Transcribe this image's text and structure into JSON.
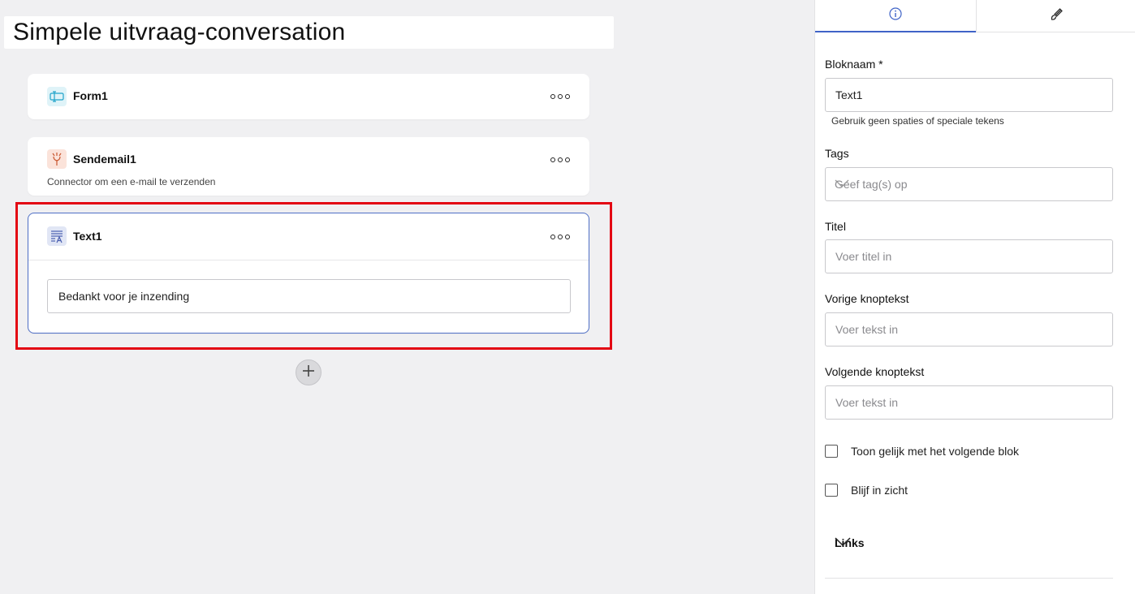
{
  "page_title": "Simpele uitvraag-conversation",
  "blocks": [
    {
      "name": "Form1",
      "icon": "form-icon",
      "icon_color": "#1fa3c9",
      "icon_bg": "#dff3f8"
    },
    {
      "name": "Sendemail1",
      "description": "Connector om een e-mail te verzenden",
      "icon": "email-connector-icon",
      "icon_color": "#c9562f",
      "icon_bg": "#fbe3da"
    },
    {
      "name": "Text1",
      "icon": "text-block-icon",
      "icon_color": "#4a5fb0",
      "icon_bg": "#e1e6f5",
      "text_value": "Bedankt voor je inzending",
      "selected": true
    }
  ],
  "highlight_color": "#e30613",
  "panel": {
    "tabs": [
      {
        "icon": "info-icon",
        "active": true
      },
      {
        "icon": "brush-icon",
        "active": false
      }
    ],
    "block_name_label": "Bloknaam *",
    "block_name_value": "Text1",
    "block_name_hint": "Gebruik geen spaties of speciale tekens",
    "tags_label": "Tags",
    "tags_placeholder": "Geef tag(s) op",
    "title_label": "Titel",
    "title_placeholder": "Voer titel in",
    "prev_label": "Vorige knoptekst",
    "prev_placeholder": "Voer tekst in",
    "next_label": "Volgende knoptekst",
    "next_placeholder": "Voer tekst in",
    "show_together_label": "Toon gelijk met het volgende blok",
    "show_together_checked": false,
    "stay_visible_label": "Blijf in zicht",
    "stay_visible_checked": false,
    "links_label": "Links"
  },
  "accent_color": "#3f63c7"
}
